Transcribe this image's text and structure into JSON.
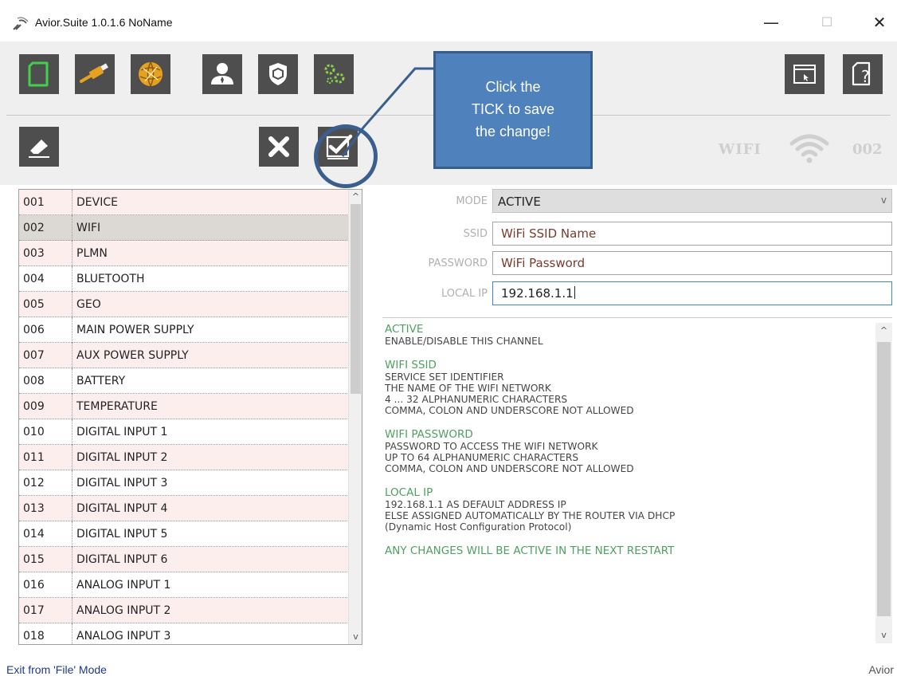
{
  "window": {
    "title": "Avior.Suite 1.0.1.6  NoName",
    "minimize_glyph": "—",
    "maximize_glyph": "☐",
    "close_glyph": "✕"
  },
  "toolbar": {
    "buttons": [
      {
        "icon": "new-file-icon",
        "color": "#3fd14a"
      },
      {
        "icon": "usb-connect-icon",
        "color": "#e6a21e"
      },
      {
        "icon": "network-globe-icon",
        "color": "#e6a21e"
      },
      {
        "icon": "user-icon",
        "color": "#ffffff"
      },
      {
        "icon": "security-shield-icon",
        "color": "#ffffff"
      },
      {
        "icon": "settings-gears-icon",
        "color": "#8bd34a"
      },
      {
        "icon": "window-cursor-icon",
        "color": "#ffffff"
      },
      {
        "icon": "help-icon",
        "color": "#ffffff"
      }
    ]
  },
  "toolbar2": {
    "erase_icon": "eraser-icon",
    "cancel_icon": "close-x-icon",
    "save_icon": "save-tick-icon",
    "section_title": "WIFI",
    "section_number": "002"
  },
  "callout": {
    "line1": "Click the",
    "line2": "TICK to save",
    "line3": "the change!",
    "fill": "#4f81bd"
  },
  "channels": [
    {
      "num": "001",
      "name": "DEVICE"
    },
    {
      "num": "002",
      "name": "WIFI"
    },
    {
      "num": "003",
      "name": "PLMN"
    },
    {
      "num": "004",
      "name": "BLUETOOTH"
    },
    {
      "num": "005",
      "name": "GEO"
    },
    {
      "num": "006",
      "name": "MAIN POWER SUPPLY"
    },
    {
      "num": "007",
      "name": "AUX POWER SUPPLY"
    },
    {
      "num": "008",
      "name": "BATTERY"
    },
    {
      "num": "009",
      "name": "TEMPERATURE"
    },
    {
      "num": "010",
      "name": "DIGITAL INPUT 1"
    },
    {
      "num": "011",
      "name": "DIGITAL INPUT 2"
    },
    {
      "num": "012",
      "name": "DIGITAL INPUT 3"
    },
    {
      "num": "013",
      "name": "DIGITAL INPUT 4"
    },
    {
      "num": "014",
      "name": "DIGITAL INPUT 5"
    },
    {
      "num": "015",
      "name": "DIGITAL INPUT 6"
    },
    {
      "num": "016",
      "name": "ANALOG INPUT 1"
    },
    {
      "num": "017",
      "name": "ANALOG INPUT 2"
    },
    {
      "num": "018",
      "name": "ANALOG INPUT 3"
    }
  ],
  "selected_channel": "002",
  "form": {
    "mode_label": "MODE",
    "mode_value": "ACTIVE",
    "ssid_label": "SSID",
    "ssid_value": "WiFi SSID Name",
    "password_label": "PASSWORD",
    "password_value": "WiFi Password",
    "local_ip_label": "LOCAL IP",
    "local_ip_value": "192.168.1.1"
  },
  "help": {
    "active_title": "ACTIVE",
    "active_l1": "ENABLE/DISABLE THIS CHANNEL",
    "ssid_title": "WIFI SSID",
    "ssid_l1": "SERVICE SET IDENTIFIER",
    "ssid_l2": "THE NAME OF THE WIFI NETWORK",
    "ssid_l3": "4 ... 32 ALPHANUMERIC CHARACTERS",
    "ssid_l4": "COMMA, COLON AND UNDERSCORE NOT ALLOWED",
    "pw_title": "WIFI PASSWORD",
    "pw_l1": "PASSWORD TO ACCESS THE WIFI NETWORK",
    "pw_l2": "UP TO 64 ALPHANUMERIC CHARACTERS",
    "pw_l3": "COMMA, COLON AND UNDERSCORE NOT ALLOWED",
    "ip_title": "LOCAL IP",
    "ip_l1": "192.168.1.1 AS DEFAULT ADDRESS IP",
    "ip_l2": "ELSE ASSIGNED AUTOMATICALLY BY THE ROUTER VIA DHCP",
    "ip_l3": "(Dynamic Host Configuration Protocol)",
    "footer": "ANY CHANGES WILL BE ACTIVE IN THE NEXT RESTART"
  },
  "status": {
    "left": "Exit from 'File' Mode",
    "right": "Avior"
  }
}
